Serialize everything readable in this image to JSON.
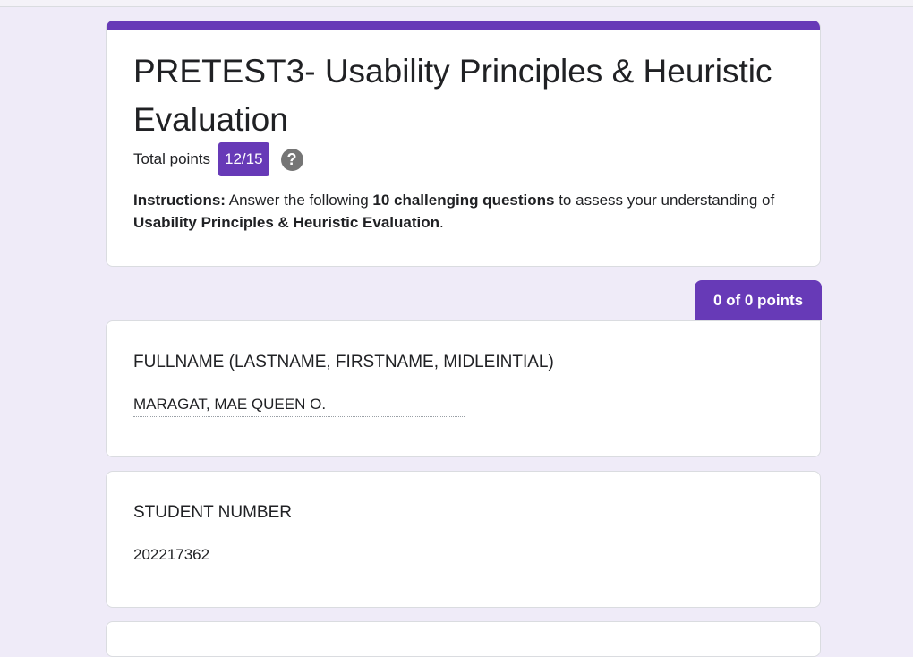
{
  "form": {
    "title": "PRETEST3- Usability Principles & Heuristic Evaluation",
    "total_points_label": "Total points",
    "score": "12/15",
    "help_icon": "question-mark-icon",
    "accent_color": "#673ab7",
    "instructions": {
      "lead": "Instructions:",
      "text1": " Answer the following ",
      "bold1": "10 challenging questions",
      "text2": " to assess your understanding of ",
      "bold2": "Usability Principles & Heuristic Evaluation",
      "text3": "."
    }
  },
  "section": {
    "points_tab": "0 of 0 points"
  },
  "questions": [
    {
      "title": "FULLNAME (LASTNAME, FIRSTNAME, MIDLEINTIAL)",
      "answer": "MARAGAT, MAE QUEEN O."
    },
    {
      "title": "STUDENT NUMBER",
      "answer": "202217362"
    }
  ]
}
